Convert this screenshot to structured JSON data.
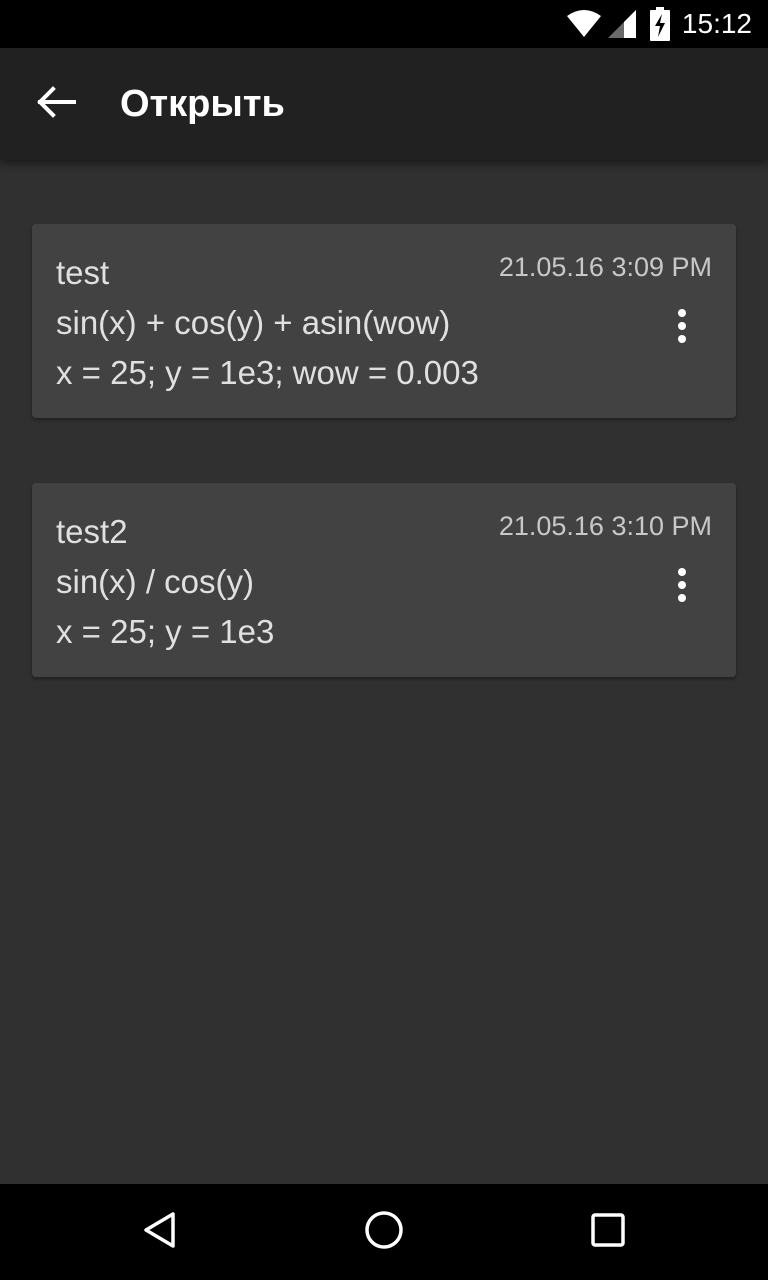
{
  "status_bar": {
    "time": "15:12",
    "icons": [
      "wifi-icon",
      "cell-signal-icon",
      "battery-charging-icon"
    ]
  },
  "app_bar": {
    "back_icon": "arrow-left-icon",
    "title": "Открыть"
  },
  "files": [
    {
      "name": "test",
      "date": "21.05.16 3:09 PM",
      "formula": "sin(x) + cos(y) + asin(wow)",
      "vars": "x = 25; y = 1e3; wow = 0.003",
      "menu_icon": "more-vert-icon"
    },
    {
      "name": "test2",
      "date": "21.05.16 3:10 PM",
      "formula": "sin(x) / cos(y)",
      "vars": "x = 25; y = 1e3",
      "menu_icon": "more-vert-icon"
    }
  ],
  "nav_bar": {
    "icons": [
      "back-triangle-icon",
      "home-circle-icon",
      "recents-square-icon"
    ]
  },
  "colors": {
    "background": "#303030",
    "app_bar": "#212121",
    "card": "#424242",
    "text_primary": "#e0e0e0",
    "text_secondary": "#c8c8c8"
  }
}
